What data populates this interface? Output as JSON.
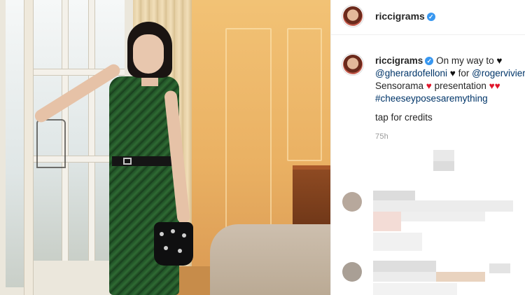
{
  "post": {
    "username": "riccigrams",
    "verified": true,
    "caption_lines": [
      {
        "segments": [
          {
            "type": "text",
            "text": "On my way to "
          },
          {
            "type": "heart",
            "color": "#111111",
            "text": "♥"
          }
        ]
      },
      {
        "segments": [
          {
            "type": "mention",
            "text": "@gherardofelloni"
          },
          {
            "type": "text",
            "text": " "
          },
          {
            "type": "heart",
            "color": "#111111",
            "text": "♥"
          },
          {
            "type": "text",
            "text": " for "
          },
          {
            "type": "mention",
            "text": "@rogervivier"
          }
        ]
      },
      {
        "segments": [
          {
            "type": "text",
            "text": "Sensorama "
          },
          {
            "type": "heart",
            "color": "#e0162b",
            "text": "♥"
          },
          {
            "type": "text",
            "text": " presentation "
          },
          {
            "type": "heart",
            "color": "#e0162b",
            "text": "♥♥"
          }
        ]
      },
      {
        "segments": [
          {
            "type": "hashtag",
            "text": "#cheeseyposesaremything"
          }
        ]
      }
    ],
    "credits_text": "tap for credits",
    "time_ago": "75h"
  },
  "icons": {
    "verified_badge": "✓"
  },
  "colors": {
    "verified_blue": "#3897f0",
    "link_blue": "#003569",
    "heart_red": "#e0162b"
  }
}
